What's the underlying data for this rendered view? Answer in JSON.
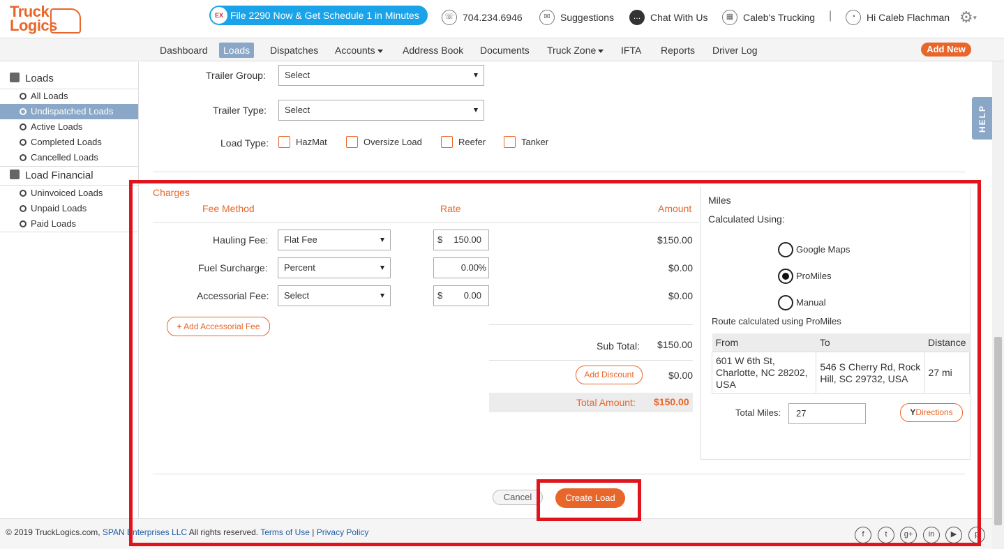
{
  "header": {
    "logo_line1": "Truck",
    "logo_line2": "Logics",
    "promo_badge": "EX",
    "promo_text": "File 2290 Now & Get Schedule 1 in Minutes",
    "phone": "704.234.6946",
    "suggestions": "Suggestions",
    "chat": "Chat With Us",
    "company": "Caleb's Trucking",
    "separator": "|",
    "greeting": "Hi Caleb Flachman"
  },
  "nav": {
    "items": [
      "Dashboard",
      "Loads",
      "Dispatches",
      "Accounts",
      "Address Book",
      "Documents",
      "Truck Zone",
      "IFTA",
      "Reports",
      "Driver Log"
    ],
    "active": "Loads",
    "add_new": "Add New"
  },
  "sidebar": {
    "loads_header": "Loads",
    "loads_items": [
      "All Loads",
      "Undispatched Loads",
      "Active Loads",
      "Completed Loads",
      "Cancelled Loads"
    ],
    "active_item": "Undispatched Loads",
    "financial_header": "Load Financial",
    "financial_items": [
      "Uninvoiced Loads",
      "Unpaid Loads",
      "Paid Loads"
    ]
  },
  "trailer": {
    "group_label": "Trailer Group:",
    "group_value": "Select",
    "type_label": "Trailer Type:",
    "type_value": "Select",
    "load_type_label": "Load Type:",
    "load_types": [
      "HazMat",
      "Oversize Load",
      "Reefer",
      "Tanker"
    ]
  },
  "charges": {
    "title": "Charges",
    "col_fee_method": "Fee Method",
    "col_rate": "Rate",
    "col_amount": "Amount",
    "rows": [
      {
        "label": "Hauling Fee:",
        "method": "Flat Fee",
        "prefix": "$",
        "rate": "150.00",
        "suffix": "",
        "amount": "$150.00"
      },
      {
        "label": "Fuel Surcharge:",
        "method": "Percent",
        "prefix": "",
        "rate": "0.00",
        "suffix": "%",
        "amount": "$0.00"
      },
      {
        "label": "Accessorial Fee:",
        "method": "Select",
        "prefix": "$",
        "rate": "0.00",
        "suffix": "",
        "amount": "$0.00"
      }
    ],
    "add_accessorial": "Add Accessorial Fee",
    "subtotal_label": "Sub Total:",
    "subtotal_value": "$150.00",
    "add_discount": "Add Discount",
    "discount_value": "$0.00",
    "total_label": "Total Amount:",
    "total_value": "$150.00"
  },
  "miles": {
    "title": "Miles",
    "calculated_using": "Calculated Using:",
    "options": [
      "Google Maps",
      "ProMiles",
      "Manual"
    ],
    "selected": "ProMiles",
    "route_note": "Route calculated using ProMiles",
    "col_from": "From",
    "col_to": "To",
    "col_distance": "Distance",
    "from": "601 W 6th St, Charlotte, NC 28202, USA",
    "to": "546 S Cherry Rd, Rock Hill, SC 29732, USA",
    "distance": "27 mi",
    "total_miles_label": "Total Miles:",
    "total_miles_value": "27",
    "directions": "Directions"
  },
  "actions": {
    "cancel": "Cancel",
    "create": "Create Load"
  },
  "help": "HELP",
  "footer": {
    "copyright": "© 2019 TruckLogics.com, ",
    "company_link": "SPAN Enterprises LLC",
    "rights": " All rights reserved. ",
    "terms": "Terms of Use",
    "divider": " | ",
    "privacy": "Privacy Policy",
    "social": [
      "f",
      "t",
      "g+",
      "in",
      "▶",
      "p"
    ]
  },
  "colors": {
    "accent": "#e8662a",
    "nav_active": "#8aa7c7",
    "promo": "#1aa3e8",
    "highlight": "#e0141c"
  }
}
